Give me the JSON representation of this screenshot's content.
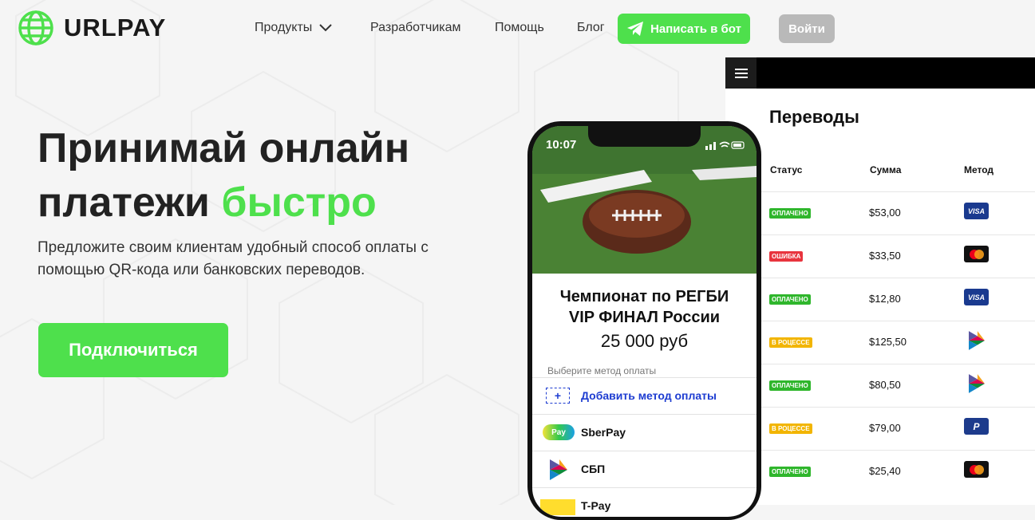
{
  "brand": {
    "name": "URLPAY",
    "accent": "#4ee04c"
  },
  "nav": {
    "products": "Продукты",
    "developers": "Разработчикам",
    "help": "Помощь",
    "blog": "Блог",
    "bot_button": "Написать в бот",
    "login_button": "Войти"
  },
  "hero": {
    "title_line1": "Принимай онлайн",
    "title_line2_plain": "платежи ",
    "title_line2_accent": "быстро",
    "subtitle": "Предложите своим клиентам удобный способ оплаты с помощью QR-кода или банковских переводов.",
    "cta": "Подключиться"
  },
  "phone": {
    "time": "10:07",
    "event_title_line1": "Чемпионат по РЕГБИ",
    "event_title_line2": "VIP ФИНАЛ России",
    "price": "25 000 руб",
    "choose_method": "Выберите метод оплаты",
    "add_method": "Добавить метод оплаты",
    "methods": [
      "SberPay",
      "СБП",
      "T-Pay"
    ],
    "sberpay_badge": "Pay"
  },
  "transfers": {
    "title": "Переводы",
    "columns": [
      "Статус",
      "Сумма",
      "Метод"
    ],
    "rows": [
      {
        "status": "ОПЛАЧЕНО",
        "amount": "$53,00",
        "method": "visa"
      },
      {
        "status": "ОШИБКА",
        "amount": "$33,50",
        "method": "mastercard"
      },
      {
        "status": "ОПЛАЧЕНО",
        "amount": "$12,80",
        "method": "visa"
      },
      {
        "status": "В РОЦЕССЕ",
        "amount": "$125,50",
        "method": "sbp"
      },
      {
        "status": "ОПЛАЧЕНО",
        "amount": "$80,50",
        "method": "sbp"
      },
      {
        "status": "В РОЦЕССЕ",
        "amount": "$79,00",
        "method": "paypal"
      },
      {
        "status": "ОПЛАЧЕНО",
        "amount": "$25,40",
        "method": "mastercard"
      }
    ],
    "status_colors": {
      "ОПЛАЧЕНО": "#2fb62c",
      "ОШИБКА": "#e8343e",
      "В РОЦЕССЕ": "#f2b500"
    },
    "visa_text": "VISA",
    "paypal_text": "P"
  }
}
